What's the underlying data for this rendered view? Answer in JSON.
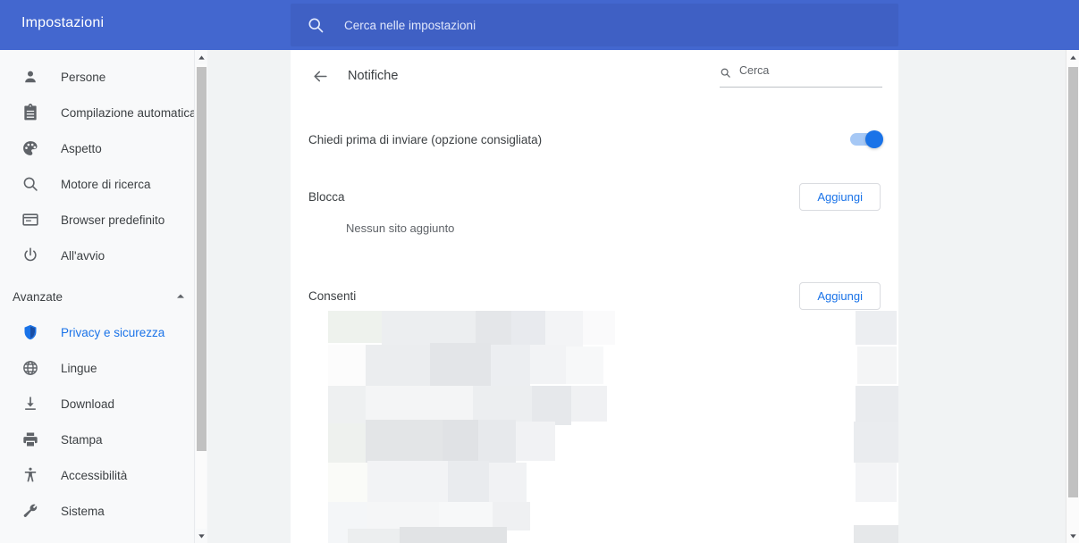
{
  "topbar": {
    "title": "Impostazioni",
    "search_icon": "search-icon",
    "search_placeholder": "Cerca nelle impostazioni",
    "background_color": "#4367cf",
    "omnibox_color": "#3f60c4"
  },
  "sidebar": {
    "items": [
      {
        "label": "Persone",
        "icon": "person-icon",
        "active": false
      },
      {
        "label": "Compilazione automatica",
        "icon": "clipboard-icon",
        "active": false
      },
      {
        "label": "Aspetto",
        "icon": "palette-icon",
        "active": false
      },
      {
        "label": "Motore di ricerca",
        "icon": "search-icon",
        "active": false
      },
      {
        "label": "Browser predefinito",
        "icon": "browser-window-icon",
        "active": false
      },
      {
        "label": "All'avvio",
        "icon": "power-icon",
        "active": false
      }
    ],
    "advanced_section": {
      "label": "Avanzate",
      "chevron_icon": "chevron-up-icon",
      "expanded": true,
      "items": [
        {
          "label": "Privacy e sicurezza",
          "icon": "shield-icon",
          "active": true
        },
        {
          "label": "Lingue",
          "icon": "globe-icon",
          "active": false
        },
        {
          "label": "Download",
          "icon": "download-icon",
          "active": false
        },
        {
          "label": "Stampa",
          "icon": "printer-icon",
          "active": false
        },
        {
          "label": "Accessibilità",
          "icon": "accessibility-icon",
          "active": false
        },
        {
          "label": "Sistema",
          "icon": "wrench-icon",
          "active": false
        }
      ]
    },
    "active_color": "#1a73e8"
  },
  "content": {
    "back_icon": "arrow-left-icon",
    "title": "Notifiche",
    "search": {
      "icon": "search-icon",
      "placeholder": "Cerca",
      "value": ""
    },
    "ask_before_sending": {
      "label": "Chiedi prima di inviare (opzione consigliata)",
      "toggle_on": true,
      "toggle_color": "#1a73e8"
    },
    "block_section": {
      "title": "Blocca",
      "add_label": "Aggiungi",
      "empty_text": "Nessun sito aggiunto"
    },
    "allow_section": {
      "title": "Consenti",
      "add_label": "Aggiungi",
      "content_state": "blurred"
    }
  },
  "scrollbars": {
    "up_icon": "triangle-up-icon",
    "down_icon": "triangle-down-icon"
  }
}
